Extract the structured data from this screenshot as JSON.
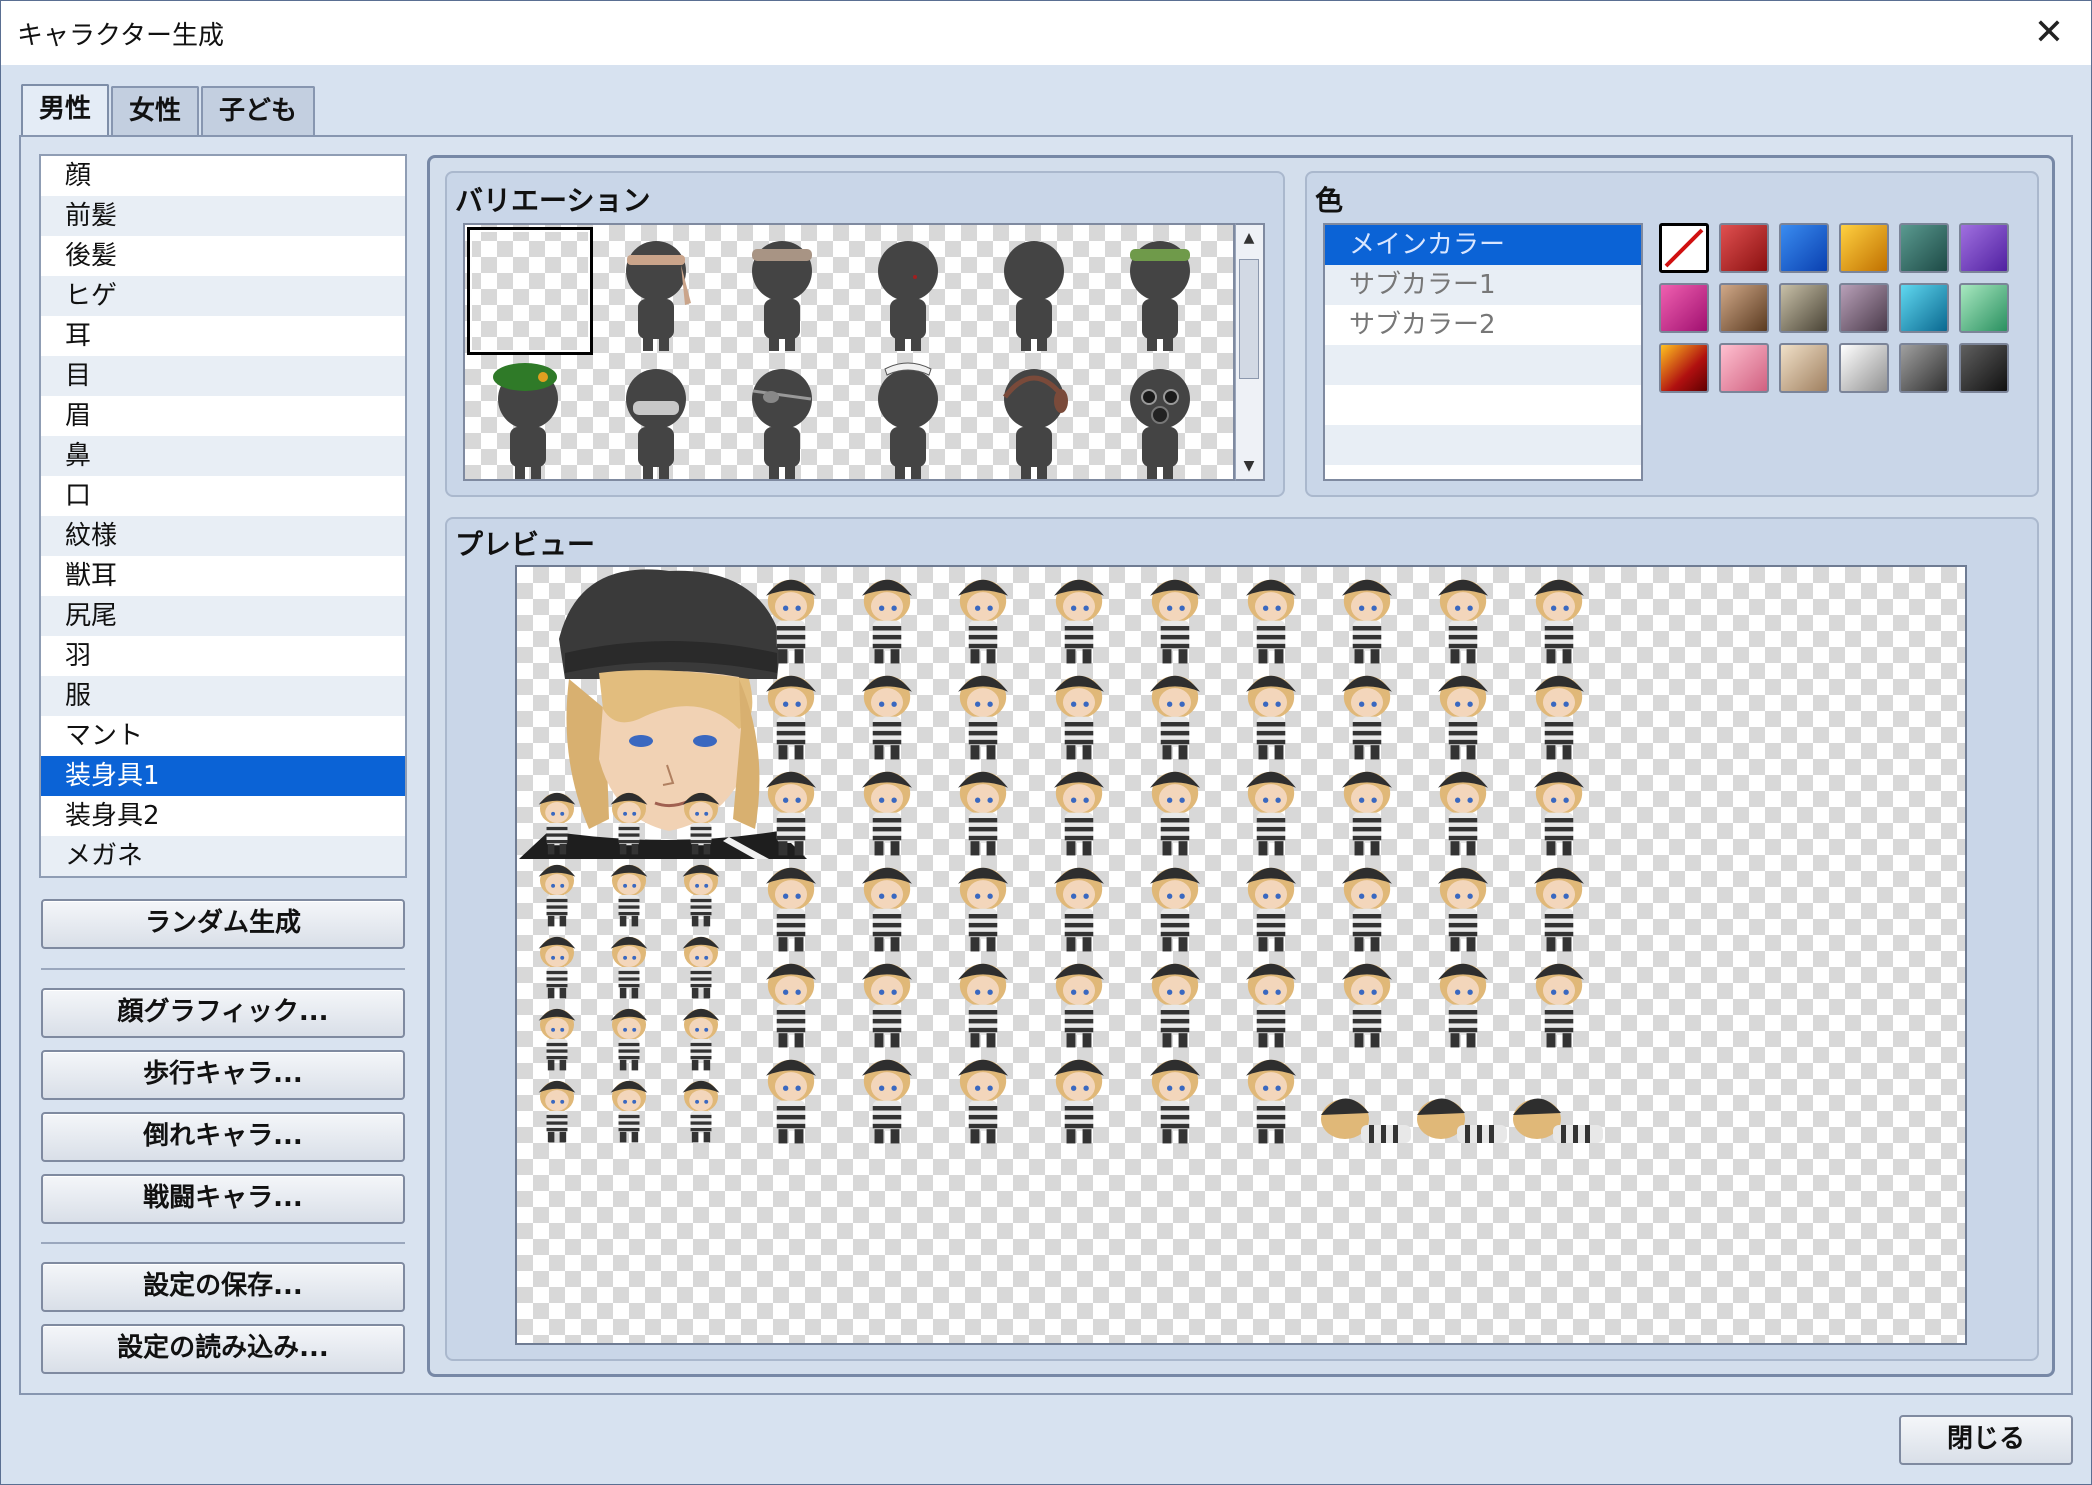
{
  "window": {
    "title": "キャラクター生成",
    "close_glyph": "✕"
  },
  "tabs": [
    {
      "label": "男性",
      "active": true
    },
    {
      "label": "女性",
      "active": false
    },
    {
      "label": "子ども",
      "active": false
    }
  ],
  "parts_list": {
    "items": [
      "顔",
      "前髪",
      "後髪",
      "ヒゲ",
      "耳",
      "目",
      "眉",
      "鼻",
      "口",
      "紋様",
      "獣耳",
      "尻尾",
      "羽",
      "服",
      "マント",
      "装身具1",
      "装身具2",
      "メガネ"
    ],
    "selected": "装身具1"
  },
  "buttons": {
    "random": "ランダム生成",
    "face_graphic": "顔グラフィック...",
    "walk_chara": "歩行キャラ...",
    "down_chara": "倒れキャラ...",
    "battle_chara": "戦闘キャラ...",
    "save_settings": "設定の保存...",
    "load_settings": "設定の読み込み...",
    "close": "閉じる"
  },
  "variation": {
    "label": "バリエーション",
    "items": [
      "none",
      "headband",
      "bandana",
      "plain-1",
      "plain-2",
      "green-bandana",
      "green-beret",
      "goggles",
      "eyepatch",
      "maid-headdress",
      "headphones",
      "gas-mask"
    ],
    "selected_index": 0
  },
  "color": {
    "label": "色",
    "targets": [
      "メインカラー",
      "サブカラー1",
      "サブカラー2"
    ],
    "selected_target": "メインカラー",
    "swatches": [
      {
        "name": "none",
        "color": "#ffffff"
      },
      {
        "name": "red",
        "color": "#b52020"
      },
      {
        "name": "blue",
        "color": "#1560d8"
      },
      {
        "name": "orange",
        "color": "#e8a010"
      },
      {
        "name": "teal",
        "color": "#2d6b66"
      },
      {
        "name": "purple",
        "color": "#7a3cc0"
      },
      {
        "name": "magenta",
        "color": "#d0308a"
      },
      {
        "name": "brown",
        "color": "#8a6040"
      },
      {
        "name": "olive-gray",
        "color": "#7a7260"
      },
      {
        "name": "mauve",
        "color": "#7a6478"
      },
      {
        "name": "cyan",
        "color": "#18a8d0"
      },
      {
        "name": "mint",
        "color": "#58c08a"
      },
      {
        "name": "fire",
        "color": "#c82010"
      },
      {
        "name": "pink",
        "color": "#e88aa8"
      },
      {
        "name": "tan",
        "color": "#c8aa88"
      },
      {
        "name": "silver",
        "color": "#b8b8b8"
      },
      {
        "name": "gray",
        "color": "#707070"
      },
      {
        "name": "charcoal",
        "color": "#303030"
      }
    ],
    "selected_swatch": "none"
  },
  "preview": {
    "label": "プレビュー"
  },
  "colors": {
    "accent": "#0b63d6",
    "panel": "#d3deec",
    "hat": "#2e2e2e",
    "hair": "#e0b878"
  }
}
